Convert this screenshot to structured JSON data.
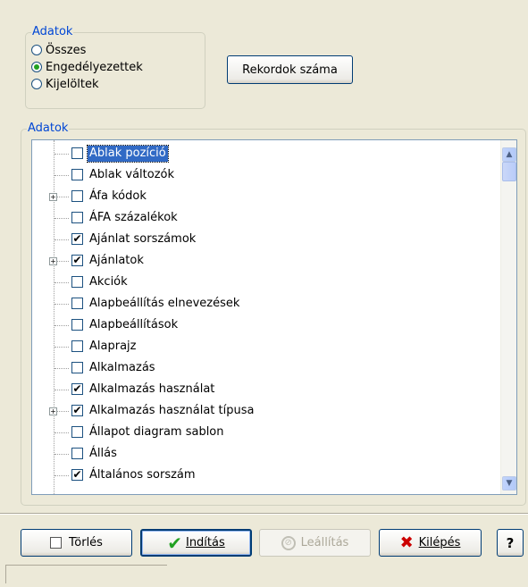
{
  "data_group": {
    "legend": "Adatok",
    "options": [
      {
        "label": "Összes",
        "selected": false
      },
      {
        "label": "Engedélyezettek",
        "selected": true
      },
      {
        "label": "Kijelöltek",
        "selected": false
      }
    ]
  },
  "record_count_button": "Rekordok száma",
  "list_group": {
    "legend": "Adatok",
    "items": [
      {
        "label": "Ablak pozíció",
        "checked": false,
        "expandable": false,
        "selected": true
      },
      {
        "label": "Ablak változók",
        "checked": false,
        "expandable": false,
        "selected": false
      },
      {
        "label": "Áfa kódok",
        "checked": false,
        "expandable": true,
        "selected": false
      },
      {
        "label": "ÁFA százalékok",
        "checked": false,
        "expandable": false,
        "selected": false
      },
      {
        "label": "Ajánlat sorszámok",
        "checked": true,
        "expandable": false,
        "selected": false
      },
      {
        "label": "Ajánlatok",
        "checked": true,
        "expandable": true,
        "selected": false
      },
      {
        "label": "Akciók",
        "checked": false,
        "expandable": false,
        "selected": false
      },
      {
        "label": "Alapbeállítás elnevezések",
        "checked": false,
        "expandable": false,
        "selected": false
      },
      {
        "label": "Alapbeállítások",
        "checked": false,
        "expandable": false,
        "selected": false
      },
      {
        "label": "Alaprajz",
        "checked": false,
        "expandable": false,
        "selected": false
      },
      {
        "label": "Alkalmazás",
        "checked": false,
        "expandable": false,
        "selected": false
      },
      {
        "label": "Alkalmazás használat",
        "checked": true,
        "expandable": false,
        "selected": false
      },
      {
        "label": "Alkalmazás használat típusa",
        "checked": true,
        "expandable": true,
        "selected": false
      },
      {
        "label": "Állapot diagram sablon",
        "checked": false,
        "expandable": false,
        "selected": false
      },
      {
        "label": "Állás",
        "checked": false,
        "expandable": false,
        "selected": false
      },
      {
        "label": "Általános sorszám",
        "checked": true,
        "expandable": false,
        "selected": false
      }
    ]
  },
  "buttons": {
    "clear": "Törlés",
    "start": "Indítás",
    "stop": "Leállítás",
    "exit": "Kilépés",
    "help": "?"
  },
  "colors": {
    "legend_text": "#0046d5",
    "selection": "#316ac5",
    "check_mark": "#21a121",
    "exit_icon": "#cc0000"
  }
}
